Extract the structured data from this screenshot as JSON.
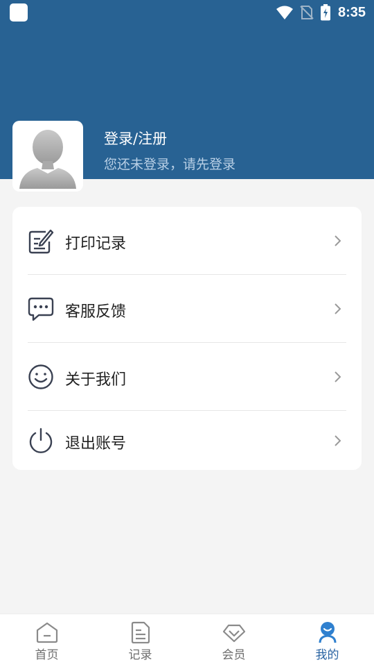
{
  "status_bar": {
    "time": "8:35"
  },
  "profile": {
    "title": "登录/注册",
    "subtitle": "您还未登录，请先登录"
  },
  "menu": [
    {
      "label": "打印记录",
      "icon": "edit-icon"
    },
    {
      "label": "客服反馈",
      "icon": "chat-icon"
    },
    {
      "label": "关于我们",
      "icon": "smile-icon"
    },
    {
      "label": "退出账号",
      "icon": "power-icon"
    }
  ],
  "bottom_nav": [
    {
      "label": "首页",
      "icon": "home-icon"
    },
    {
      "label": "记录",
      "icon": "document-icon"
    },
    {
      "label": "会员",
      "icon": "diamond-icon"
    },
    {
      "label": "我的",
      "icon": "user-icon",
      "active": true
    }
  ],
  "colors": {
    "header": "#286293",
    "active_tab": "#2a63a2",
    "page_bg": "#f4f4f4"
  }
}
